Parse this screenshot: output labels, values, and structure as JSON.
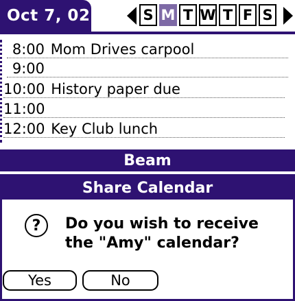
{
  "header": {
    "date": "Oct 7, 02",
    "days": [
      "S",
      "M",
      "T",
      "W",
      "T",
      "F",
      "S"
    ],
    "active_day_index": 1
  },
  "schedule": [
    {
      "time": "8:00",
      "event": "Mom Drives carpool"
    },
    {
      "time": "9:00",
      "event": ""
    },
    {
      "time": "10:00",
      "event": "History paper due"
    },
    {
      "time": "11:00",
      "event": ""
    },
    {
      "time": "12:00",
      "event": "Key Club lunch"
    }
  ],
  "beam_bar": {
    "label": "Beam"
  },
  "dialog": {
    "title": "Share Calendar",
    "icon_name": "question-icon",
    "icon_glyph": "?",
    "message_line1": "Do you wish to receive",
    "message_line2": "the  \"Amy\" calendar?",
    "yes_label": "Yes",
    "no_label": "No"
  },
  "colors": {
    "primary": "#2e1272",
    "accent": "#7e6aa6",
    "background": "#ffffff"
  }
}
